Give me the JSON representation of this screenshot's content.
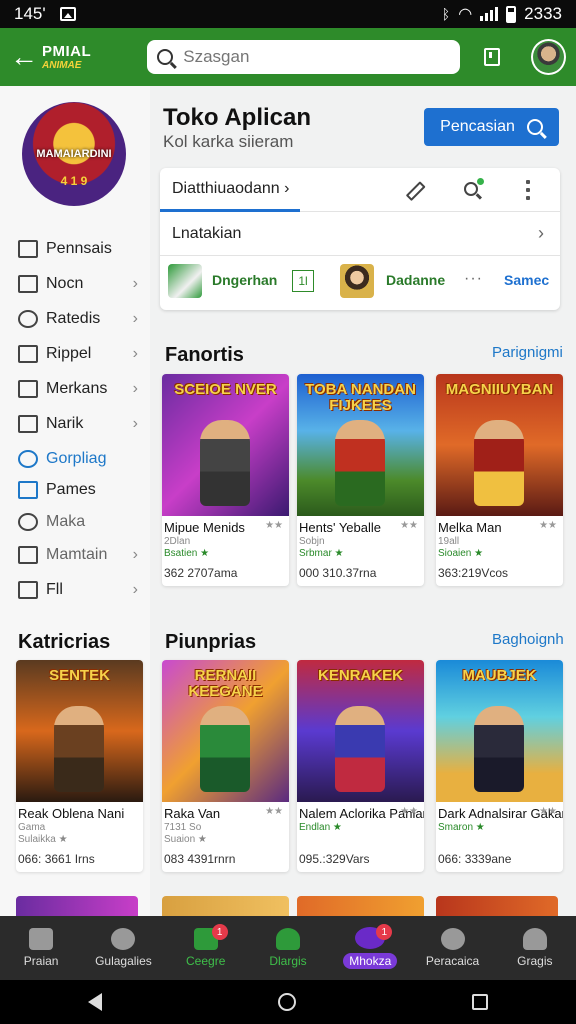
{
  "status": {
    "time": "145'",
    "right_time": "2333"
  },
  "header": {
    "logo_line1": "PMIAL",
    "logo_line2": "ANIMAE",
    "search_placeholder": "Szasgan"
  },
  "sidebar": {
    "game_logo_text": "MAMAIARDINI",
    "game_logo_sub": "4 1 9",
    "items": [
      {
        "label": "Pennsais",
        "chevron": false
      },
      {
        "label": "Nocn",
        "chevron": true
      },
      {
        "label": "Ratedis",
        "chevron": true
      },
      {
        "label": "Rippel",
        "chevron": true
      },
      {
        "label": "Merkans",
        "chevron": true
      },
      {
        "label": "Narik",
        "chevron": true
      },
      {
        "label": "Gorpliag",
        "chevron": false,
        "active": true
      },
      {
        "label": "Pames",
        "chevron": false
      },
      {
        "label": "Maka",
        "chevron": false
      },
      {
        "label": "Mamtain",
        "chevron": true
      },
      {
        "label": "Fll",
        "chevron": true
      }
    ]
  },
  "main": {
    "title": "Toko Aplican",
    "subtitle": "Kol karka siieram",
    "primary_button": "Pencasian",
    "card": {
      "tab": "Diatthiuaodann  ›",
      "row2": "Lnatakian",
      "row3_left_label": "Dngerhan",
      "row3_badge": "1l",
      "row3_right_label": "Dadanne",
      "row3_more": "···",
      "row3_link": "Samec"
    }
  },
  "sections": {
    "favorites": {
      "title": "Fanortis",
      "link": "Parignigmi"
    },
    "categories": {
      "title": "Katricrias"
    },
    "popular": {
      "title": "Piunprias",
      "link": "Baghoignh"
    }
  },
  "games_row1": [
    {
      "art_title": "SCEIOE NVER",
      "name": "Mipue Menids",
      "rating": "★★",
      "sub": "2Dlan",
      "meta": "Bsatien ★",
      "stat": "362 2707ama"
    },
    {
      "art_title": "TOBA NANDAN\nFIJKEES",
      "name": "Hents' Yeballe",
      "rating": "★★",
      "sub": "Sobjn",
      "meta": "Srbmar ★",
      "stat": "000 310.37rna"
    },
    {
      "art_title": "MAGNIIUYBAN",
      "name": "Melka Man",
      "rating": "★★",
      "sub": "19all",
      "meta": "Sioaien ★",
      "stat": "363:219Vcos"
    }
  ],
  "games_row2": [
    {
      "art_title": "SENTEK",
      "name": "Reak Oblena Nani",
      "rating": "",
      "sub": "Gama",
      "meta": "Sulaikka ★",
      "stat": "066: 3661 Irns"
    },
    {
      "art_title": "RERNAII KEEGANE",
      "name": "Raka Van",
      "rating": "★★",
      "sub": "7131 So",
      "meta": "Suaion ★",
      "stat": "083 4391rnrn"
    },
    {
      "art_title": "KENRAKEK",
      "name": "Nalem Aclorika Panian",
      "rating": "★★",
      "sub": "",
      "meta": "Endlan ★",
      "stat": "095.:329Vars"
    },
    {
      "art_title": "MAUBJEK",
      "name": "Dark Adnalsirar Gakan",
      "rating": "★★",
      "sub": "",
      "meta": "Smaron ★",
      "stat": "066: 3339ane"
    }
  ],
  "bottom_nav": [
    {
      "label": "Praian",
      "badge": ""
    },
    {
      "label": "Gulagalies",
      "badge": ""
    },
    {
      "label": "Ceegre",
      "badge": "1",
      "green": true
    },
    {
      "label": "Dlargis",
      "badge": ""
    },
    {
      "label": "Mhokza",
      "badge": "1",
      "active": true
    },
    {
      "label": "Peracaica",
      "badge": ""
    },
    {
      "label": "Gragis",
      "badge": ""
    }
  ],
  "colors": {
    "header_green": "#2e8b2a",
    "accent_blue": "#1e70d0",
    "nav_dark": "#2b2b2b"
  }
}
